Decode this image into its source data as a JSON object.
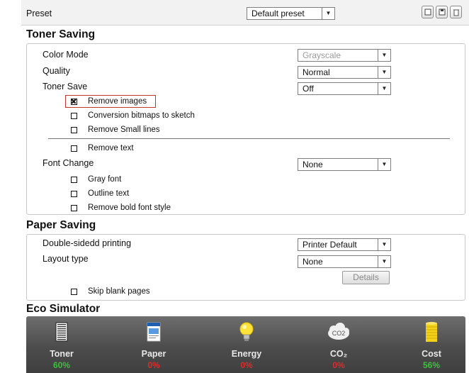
{
  "preset": {
    "label": "Preset",
    "selected": "Default preset"
  },
  "toner_saving": {
    "title": "Toner Saving",
    "color_mode": {
      "label": "Color Mode",
      "value": "Grayscale"
    },
    "quality": {
      "label": "Quality",
      "value": "Normal"
    },
    "toner_save": {
      "label": "Toner Save",
      "value": "Off",
      "options": [
        {
          "label": "Remove images",
          "checked": true
        },
        {
          "label": "Conversion bitmaps to sketch",
          "checked": false
        },
        {
          "label": "Remove Small lines",
          "checked": false
        },
        {
          "label": "Remove text",
          "checked": false
        }
      ]
    },
    "font_change": {
      "label": "Font Change",
      "value": "None",
      "options": [
        {
          "label": "Gray font",
          "checked": false
        },
        {
          "label": "Outline text",
          "checked": false
        },
        {
          "label": "Remove bold font style",
          "checked": false
        }
      ]
    }
  },
  "paper_saving": {
    "title": "Paper Saving",
    "double_sided": {
      "label": "Double-sidedd printing",
      "value": "Printer Default"
    },
    "layout_type": {
      "label": "Layout type",
      "value": "None"
    },
    "details_label": "Details",
    "skip_blank": {
      "label": "Skip blank pages",
      "checked": false
    }
  },
  "eco_simulator": {
    "title": "Eco Simulator",
    "items": [
      {
        "label": "Toner",
        "value": "60%",
        "color": "#3fbf3f",
        "icon": "toner-icon"
      },
      {
        "label": "Paper",
        "value": "0%",
        "color": "#e02a2a",
        "icon": "paper-icon"
      },
      {
        "label": "Energy",
        "value": "0%",
        "color": "#e02a2a",
        "icon": "bulb-icon"
      },
      {
        "label": "CO₂",
        "value": "0%",
        "color": "#e02a2a",
        "icon": "co2-cloud-icon",
        "icon_text": "CO2"
      },
      {
        "label": "Cost",
        "value": "56%",
        "color": "#3fbf3f",
        "icon": "coins-icon"
      }
    ]
  }
}
